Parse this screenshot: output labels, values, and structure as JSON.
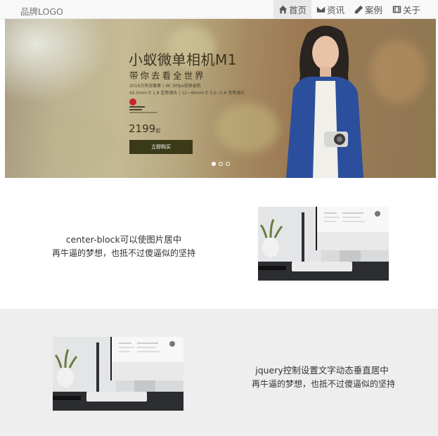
{
  "navbar": {
    "brand": "品牌LOGO",
    "items": [
      {
        "label": "首页",
        "icon": "home-icon",
        "active": true
      },
      {
        "label": "资讯",
        "icon": "envelope-icon",
        "active": false
      },
      {
        "label": "案例",
        "icon": "pencil-icon",
        "active": false
      },
      {
        "label": "关于",
        "icon": "film-icon",
        "active": false
      }
    ]
  },
  "carousel": {
    "headline": "小蚁微单相机M1",
    "subline": "带你去看全世界",
    "specs": [
      "2016万有效像素 | 4K 30fps视频录制",
      "42.5mm f/ 1.8 定焦镜头 | 12~40mm f/ 3.5~5.6 变焦镜头"
    ],
    "price": "2199",
    "price_unit": "起",
    "buy_label": "立即购买",
    "slide_count": 3,
    "active_slide": 0
  },
  "features": [
    {
      "title": "center-block可以使图片居中",
      "description": "再牛逼的梦想，也抵不过傻逼似的坚持"
    },
    {
      "title": "jquery控制设置文字动态垂直居中",
      "description": "再牛逼的梦想，也抵不过傻逼似的坚持"
    }
  ],
  "colors": {
    "accent_button": "#3b3a18",
    "navbar_bg": "#f8f8f8",
    "row_alt_bg": "#eeeeee"
  }
}
